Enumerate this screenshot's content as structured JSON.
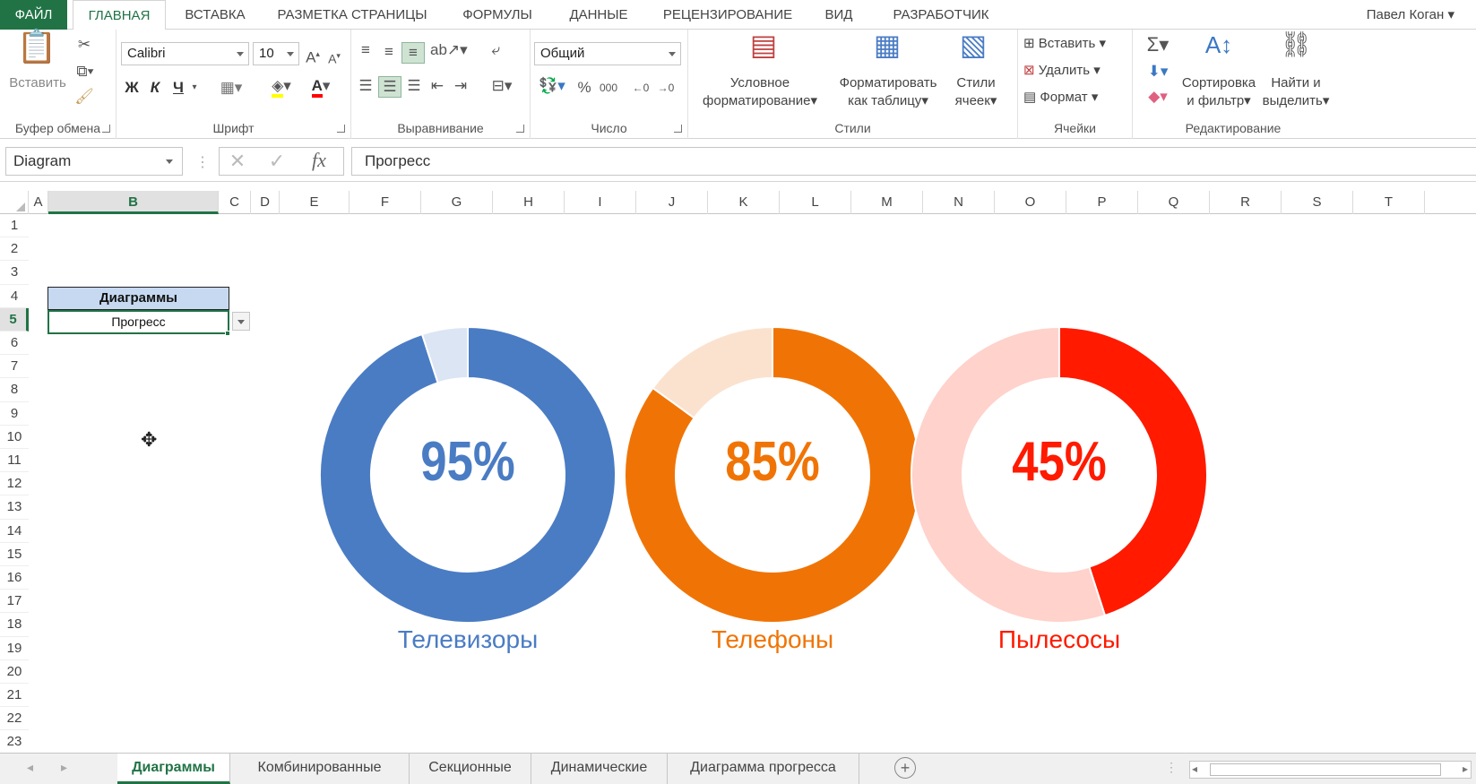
{
  "ribbon_tabs": [
    "ФАЙЛ",
    "ГЛАВНАЯ",
    "ВСТАВКА",
    "РАЗМЕТКА СТРАНИЦЫ",
    "ФОРМУЛЫ",
    "ДАННЫЕ",
    "РЕЦЕНЗИРОВАНИЕ",
    "ВИД",
    "РАЗРАБОТЧИК"
  ],
  "user_name": "Павел Коган",
  "clipboard": {
    "paste_label": "Вставить",
    "group_label": "Буфер обмена"
  },
  "font": {
    "name": "Calibri",
    "size": "10",
    "bold": "Ж",
    "italic": "К",
    "underline": "Ч",
    "group_label": "Шрифт"
  },
  "alignment": {
    "group_label": "Выравнивание"
  },
  "number": {
    "format": "Общий",
    "percent": "%",
    "thousands": "000",
    "group_label": "Число"
  },
  "styles": {
    "conditional_line1": "Условное",
    "conditional_line2": "форматирование",
    "format_table_line1": "Форматировать",
    "format_table_line2": "как таблицу",
    "cell_styles_line1": "Стили",
    "cell_styles_line2": "ячеек",
    "group_label": "Стили"
  },
  "cells": {
    "insert": "Вставить",
    "delete": "Удалить",
    "format": "Формат",
    "group_label": "Ячейки"
  },
  "editing": {
    "sort_line1": "Сортировка",
    "sort_line2": "и фильтр",
    "find_line1": "Найти и",
    "find_line2": "выделить",
    "group_label": "Редактирование"
  },
  "formula_bar": {
    "name_box": "Diagram",
    "formula": "Прогресс",
    "fx": "fx"
  },
  "columns": [
    "A",
    "B",
    "C",
    "D",
    "E",
    "F",
    "G",
    "H",
    "I",
    "J",
    "K",
    "L",
    "M",
    "N",
    "O",
    "P",
    "Q",
    "R",
    "S",
    "T"
  ],
  "rows": [
    "1",
    "2",
    "3",
    "4",
    "5",
    "6",
    "7",
    "8",
    "9",
    "10",
    "11",
    "12",
    "13",
    "14",
    "15",
    "16",
    "17",
    "18",
    "19",
    "20",
    "21",
    "22",
    "23"
  ],
  "sheet_cells": {
    "b4": "Диаграммы",
    "b5": "Прогресс"
  },
  "colors": {
    "accent": "#217346",
    "tv": "#4a7cc4",
    "tv_rest": "#dbe5f4",
    "phones": "#f07405",
    "phones_rest": "#fbe2cf",
    "vacuum": "#ff1a00",
    "vacuum_rest": "#ffd2cc"
  },
  "chart_data": [
    {
      "type": "pie",
      "variant": "donut",
      "label": "Телевизоры",
      "value_label": "95%",
      "values": [
        95,
        5
      ],
      "colors": [
        "#4a7cc4",
        "#dbe5f4"
      ]
    },
    {
      "type": "pie",
      "variant": "donut",
      "label": "Телефоны",
      "value_label": "85%",
      "values": [
        85,
        15
      ],
      "colors": [
        "#f07405",
        "#fbe2cf"
      ]
    },
    {
      "type": "pie",
      "variant": "donut",
      "label": "Пылесосы",
      "value_label": "45%",
      "values": [
        45,
        55
      ],
      "colors": [
        "#ff1a00",
        "#ffd2cc"
      ]
    }
  ],
  "sheet_tabs": [
    "Диаграммы",
    "Комбинированные",
    "Секционные",
    "Динамические",
    "Диаграмма прогресса"
  ],
  "active_sheet": "Диаграммы"
}
